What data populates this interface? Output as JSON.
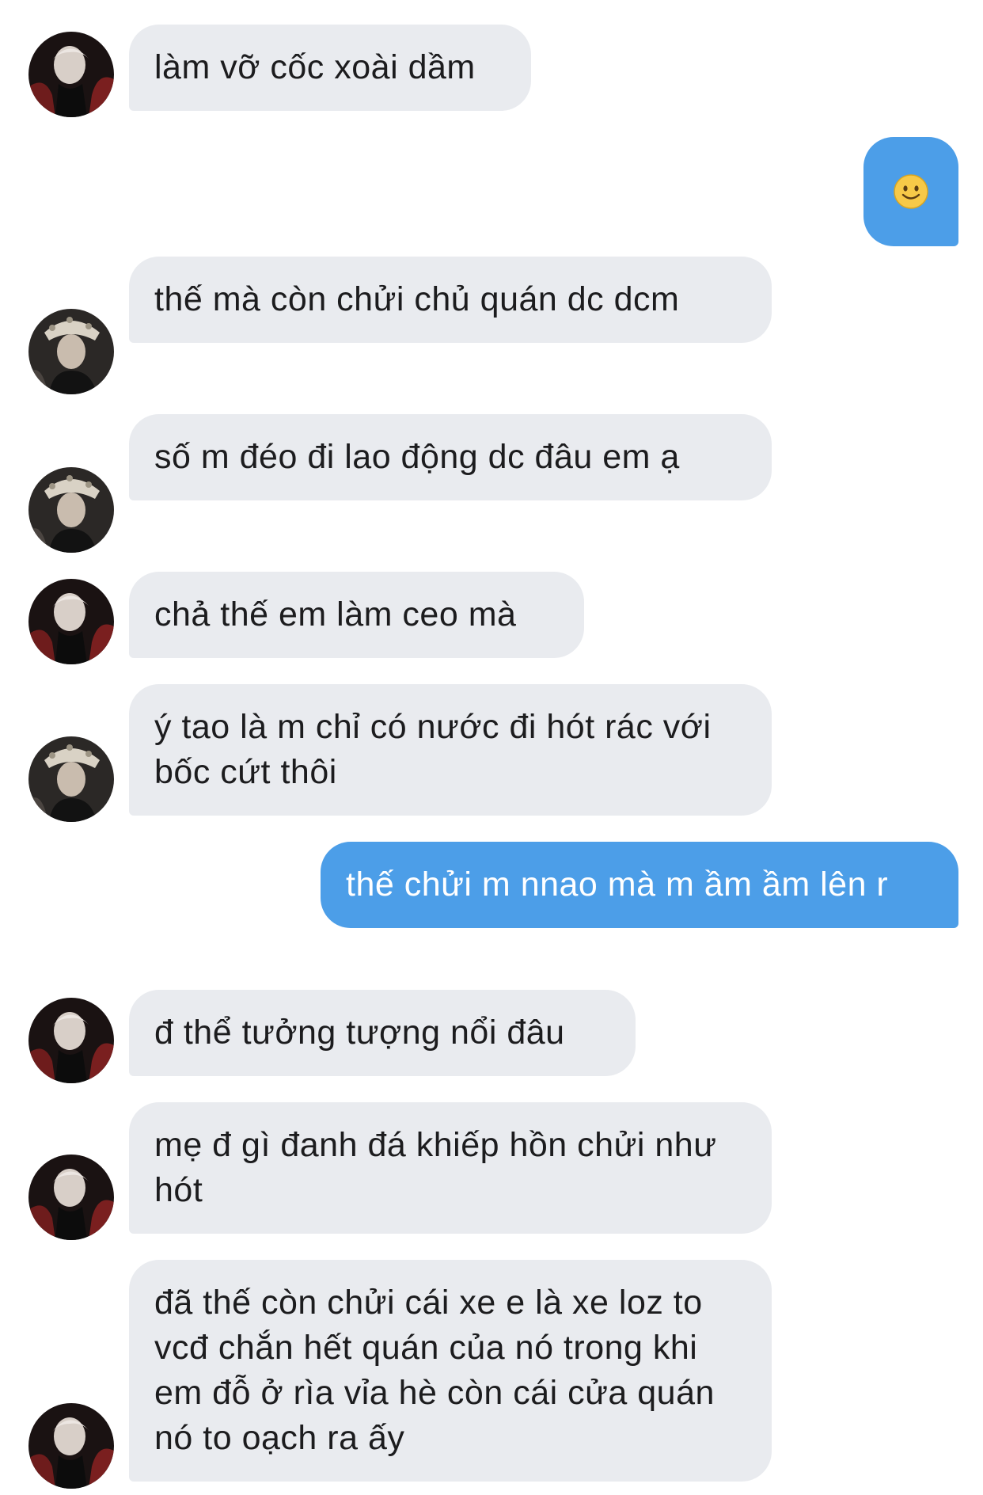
{
  "conversation": {
    "messages": [
      {
        "sender": "contact",
        "avatar": "avatar-a",
        "text": "làm vỡ cốc xoài dầm"
      },
      {
        "sender": "me",
        "emoji": "slightly-smiling-face-icon",
        "text": ""
      },
      {
        "sender": "contact",
        "avatar": "avatar-b",
        "text": "thế mà còn chửi chủ quán dc dcm"
      },
      {
        "sender": "contact",
        "avatar": "avatar-b",
        "text": "số m đéo đi lao động dc đâu em ạ"
      },
      {
        "sender": "contact",
        "avatar": "avatar-a",
        "text": "chả thế em làm ceo mà"
      },
      {
        "sender": "contact",
        "avatar": "avatar-b",
        "text": "ý tao là m chỉ có nước đi hót rác với bốc cứt thôi"
      },
      {
        "sender": "me",
        "text": "thế chửi m nnao mà m ầm ầm lên r"
      },
      {
        "sender": "contact",
        "avatar": "avatar-a",
        "text": "đ thể tưởng tượng nổi đâu"
      },
      {
        "sender": "contact",
        "avatar": "avatar-a",
        "text": "mẹ đ gì đanh đá khiếp hồn chửi như hót"
      },
      {
        "sender": "contact",
        "avatar": "avatar-a",
        "text": "đã thế còn chửi cái xe e là xe loz to vcđ chắn hết quán của nó trong khi em đỗ ở rìa vỉa hè còn cái cửa quán nó to oạch ra ấy"
      }
    ]
  },
  "colors": {
    "incoming_bubble": "#e9ebef",
    "outgoing_bubble": "#4c9ee8",
    "incoming_text": "#1c1c1e",
    "outgoing_text": "#ffffff"
  }
}
